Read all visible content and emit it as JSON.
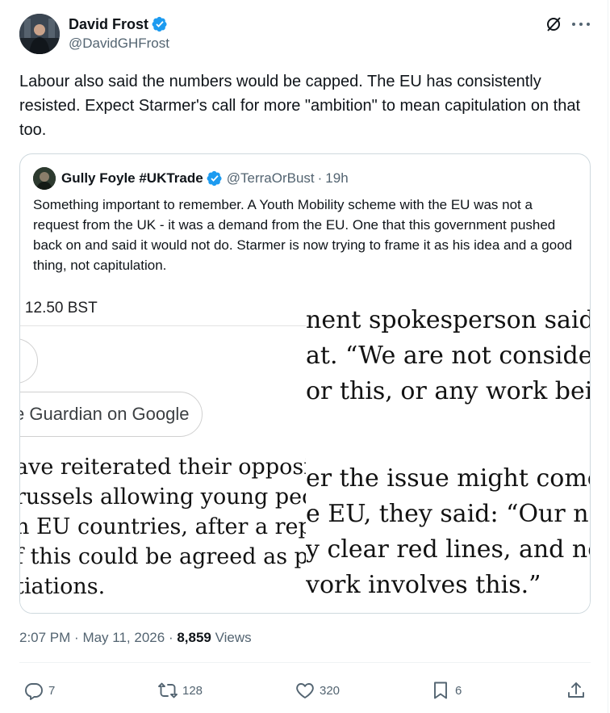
{
  "tweet": {
    "author_name": "David Frost",
    "author_handle": "@DavidGHFrost",
    "text": "Labour also said the numbers would be capped. The EU has consistently resisted.  Expect Starmer's call for more \"ambition\" to mean capitulation on that too.",
    "time": "2:07 PM",
    "date": "May 11, 2026",
    "views_count": "8,859",
    "views_label": "Views"
  },
  "quoted": {
    "author_name": "Gully Foyle #UKTrade",
    "author_handle": "@TerraOrBust",
    "age": "19h",
    "text": "Something important to remember. A Youth Mobility scheme with the EU was not a request from the UK - it was a demand from the EU. One that this government pushed back on and said it would not do. Starmer is now trying to frame it as his idea and a good thing, not capitulation.",
    "image": {
      "left_time": "• 12.50 BST",
      "left_button": "e Guardian on Google",
      "left_lines": [
        "ave reiterated their oppositi",
        "russels allowing young peop",
        "n EU countries, after a report",
        "f this could be agreed as part",
        "tiations."
      ],
      "right_top_lines": [
        "nent spokesperson said t",
        "at. “We are not consider",
        "or this, or any work bein"
      ],
      "right_bottom_lines": [
        "er the issue might come",
        "e EU, they said: “Our neg",
        "y clear red lines, and non",
        "vork involves this.”"
      ]
    }
  },
  "actions": {
    "replies": "7",
    "reposts": "128",
    "likes": "320",
    "bookmarks": "6"
  },
  "icons": {
    "verified": "verified-badge-icon",
    "grok": "grok-icon",
    "more": "more-icon",
    "reply": "reply-icon",
    "repost": "repost-icon",
    "like": "heart-icon",
    "bookmark": "bookmark-icon",
    "share": "share-icon"
  },
  "colors": {
    "verified": "#1d9bf0",
    "secondary_text": "#536471",
    "primary_text": "#0f1419",
    "border": "#cfd9de"
  }
}
